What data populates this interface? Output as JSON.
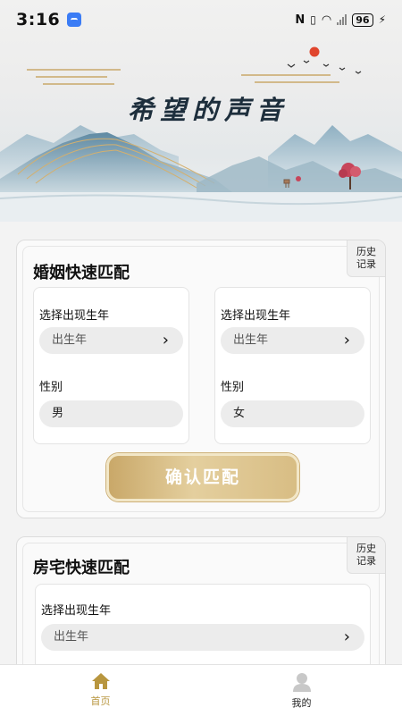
{
  "status_bar": {
    "time": "3:16",
    "battery": "96"
  },
  "banner": {
    "title": "希望的声音"
  },
  "marriage_card": {
    "title": "婚姻快速匹配",
    "history_label_line1": "历史",
    "history_label_line2": "记录",
    "left_person": {
      "year_label": "选择出现生年",
      "year_placeholder": "出生年",
      "gender_label": "性别",
      "gender_value": "男"
    },
    "right_person": {
      "year_label": "选择出现生年",
      "year_placeholder": "出生年",
      "gender_label": "性别",
      "gender_value": "女"
    },
    "confirm_label": "确认匹配"
  },
  "house_card": {
    "title": "房宅快速匹配",
    "history_label_line1": "历史",
    "history_label_line2": "记录",
    "year_label": "选择出现生年",
    "year_placeholder": "出生年"
  },
  "nav": {
    "home_label": "首页",
    "mine_label": "我的",
    "active_color": "#b8963f"
  },
  "colors": {
    "gold_accent": "#c9a869",
    "banner_sun": "#e0452d"
  }
}
